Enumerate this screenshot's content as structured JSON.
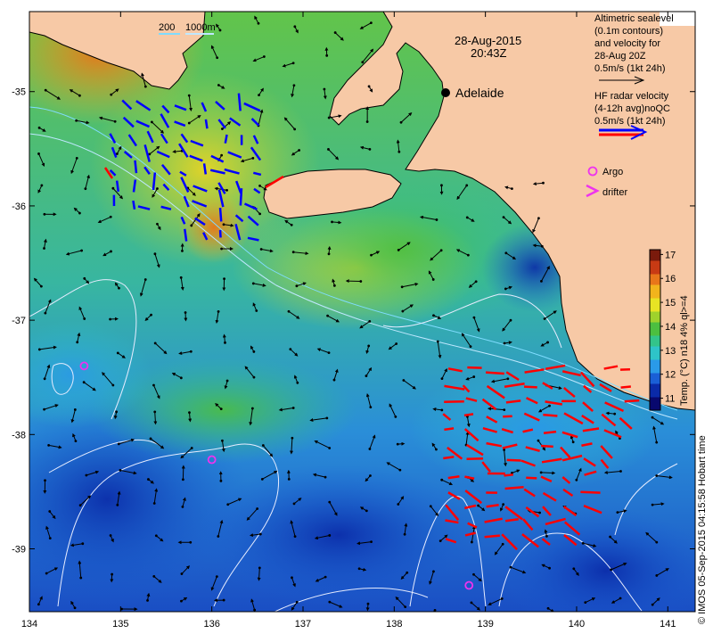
{
  "title": {
    "date": "28-Aug-2015",
    "time": "20:43Z"
  },
  "bathymetry_labels": {
    "shallow": "200",
    "deep": "1000m"
  },
  "place_labels": [
    {
      "name": "Adelaide",
      "lon": 138.6,
      "lat": -34.93
    }
  ],
  "legend": {
    "sealevel": [
      "Altimetric sealevel",
      "(0.1m contours)",
      "and velocity for",
      "28-Aug 20Z",
      "0.5m/s (1kt 24h)"
    ],
    "hf_radar": [
      "HF radar velocity",
      "(4-12h avg)noQC",
      "0.5m/s (1kt 24h)"
    ],
    "argo": "Argo",
    "drifter": "drifter"
  },
  "colorbar": {
    "title": "Temp. (°C) n18 4% ql>=4",
    "ticks": [
      "11",
      "12",
      "13",
      "14",
      "15",
      "16",
      "17"
    ],
    "min": 10.5,
    "max": 17.2,
    "colors": [
      "#08086e",
      "#0a2aa8",
      "#1a5fd6",
      "#2a9ae8",
      "#2ec4c8",
      "#33c48a",
      "#4cbf40",
      "#9fd22c",
      "#e8e424",
      "#f2b41c",
      "#e8761a",
      "#c83a14",
      "#7a1a0c"
    ]
  },
  "axes": {
    "x_ticks": [
      "134",
      "135",
      "136",
      "137",
      "138",
      "139",
      "140",
      "141"
    ],
    "y_ticks": [
      "-35",
      "-36",
      "-37",
      "-38",
      "-39"
    ],
    "lon_range": [
      134,
      141.3
    ],
    "lat_range": [
      -39.55,
      -34.3
    ]
  },
  "argo_floats": [
    {
      "lon": 134.6,
      "lat": -37.4
    },
    {
      "lon": 136.0,
      "lat": -38.22
    },
    {
      "lon": 138.82,
      "lat": -39.32
    }
  ],
  "credit": "© IMOS 05-Sep-2015 04:15:58 Hobart time",
  "colors": {
    "land": "#f7c9a6",
    "coast": "#000000",
    "hf_blue": "#0000ff",
    "hf_red": "#ff0000",
    "argo": "#ee33ee",
    "contour": "#e6ecff"
  }
}
